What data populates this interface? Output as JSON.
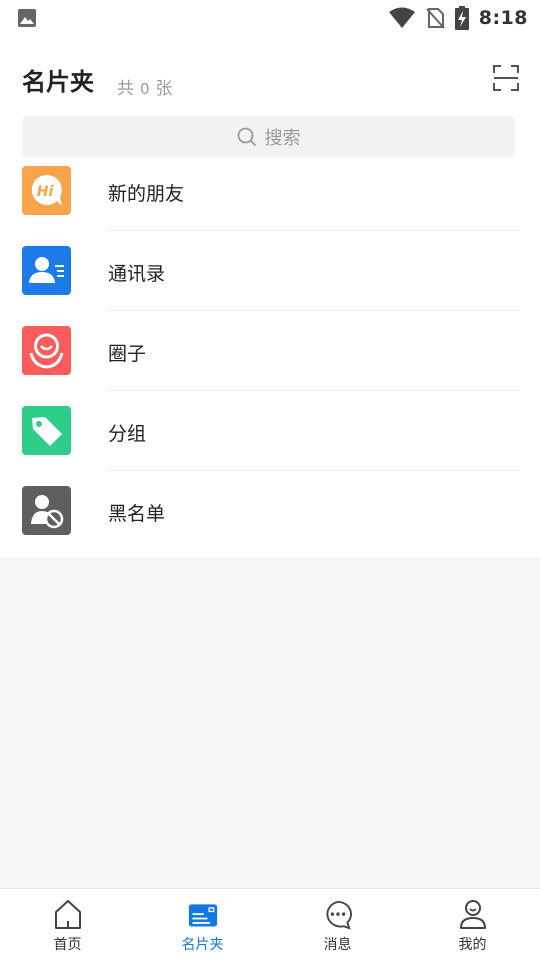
{
  "status_bar": {
    "time": "8:18",
    "icons": [
      "gallery-icon",
      "wifi-icon",
      "no-sim-icon",
      "battery-charging-icon"
    ]
  },
  "header": {
    "title": "名片夹",
    "count_prefix": "共",
    "count": "0",
    "count_suffix": "张",
    "scan_icon": "scan-icon"
  },
  "search": {
    "placeholder": "搜索",
    "icon": "search-icon"
  },
  "menu": {
    "items": [
      {
        "label": "新的朋友",
        "icon": "hi-bubble-icon",
        "color": "#f7a44b"
      },
      {
        "label": "通讯录",
        "icon": "contacts-icon",
        "color": "#1c7be6"
      },
      {
        "label": "圈子",
        "icon": "circle-group-icon",
        "color": "#fa5b5b"
      },
      {
        "label": "分组",
        "icon": "tag-icon",
        "color": "#2fcd8a"
      },
      {
        "label": "黑名单",
        "icon": "blocked-user-icon",
        "color": "#5f5f5f"
      }
    ]
  },
  "tabbar": {
    "active_color": "#1479e3",
    "tabs": [
      {
        "label": "首页",
        "icon": "home-icon"
      },
      {
        "label": "名片夹",
        "icon": "card-holder-icon",
        "active": true
      },
      {
        "label": "消息",
        "icon": "message-icon"
      },
      {
        "label": "我的",
        "icon": "profile-icon"
      }
    ]
  }
}
